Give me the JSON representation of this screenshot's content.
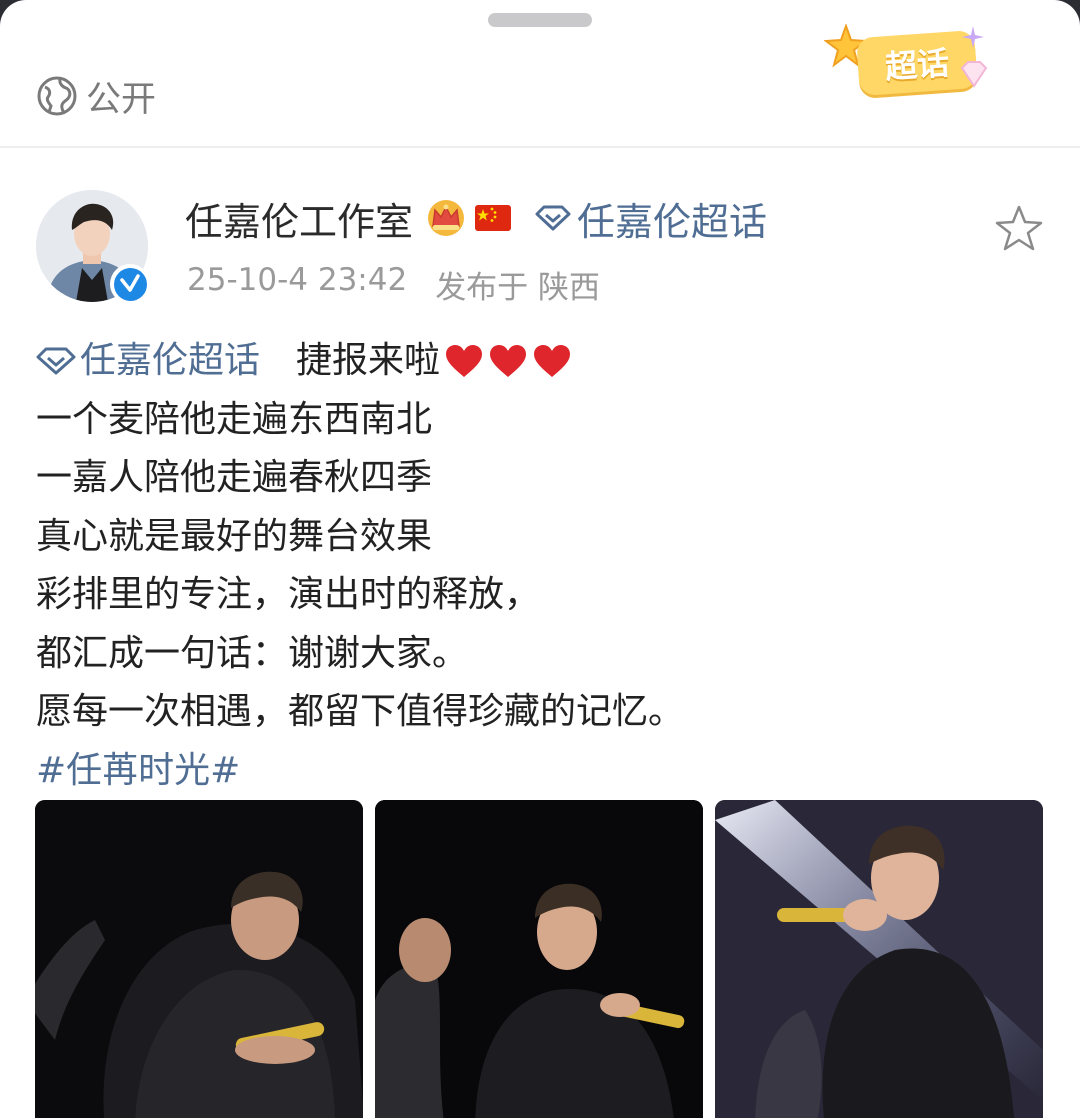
{
  "visibility": {
    "label": "公开",
    "icon": "globe-icon"
  },
  "supertopic_badge": {
    "label": "超话"
  },
  "post": {
    "author": "任嘉伦工作室",
    "author_badges": [
      "crown-icon",
      "china-flag-icon"
    ],
    "topic": "任嘉伦超话",
    "timestamp": "25-10-4 23:42",
    "location": "发布于 陕西",
    "body": {
      "topic_tag": "任嘉伦超话",
      "first_text": "捷报来啦",
      "lines": [
        "一个麦陪他走遍东西南北",
        "一嘉人陪他走遍春秋四季",
        "真心就是最好的舞台效果",
        "彩排里的专注，演出时的释放，",
        "都汇成一句话：谢谢大家。",
        "愿每一次相遇，都留下值得珍藏的记忆。"
      ],
      "hashtag": "#任苒时光#"
    }
  },
  "colors": {
    "link": "#506e94",
    "text": "#222222",
    "meta": "#9a9a9a",
    "verified": "#1e88e5",
    "badge": "#ffd766",
    "heart": "#e0262d"
  }
}
